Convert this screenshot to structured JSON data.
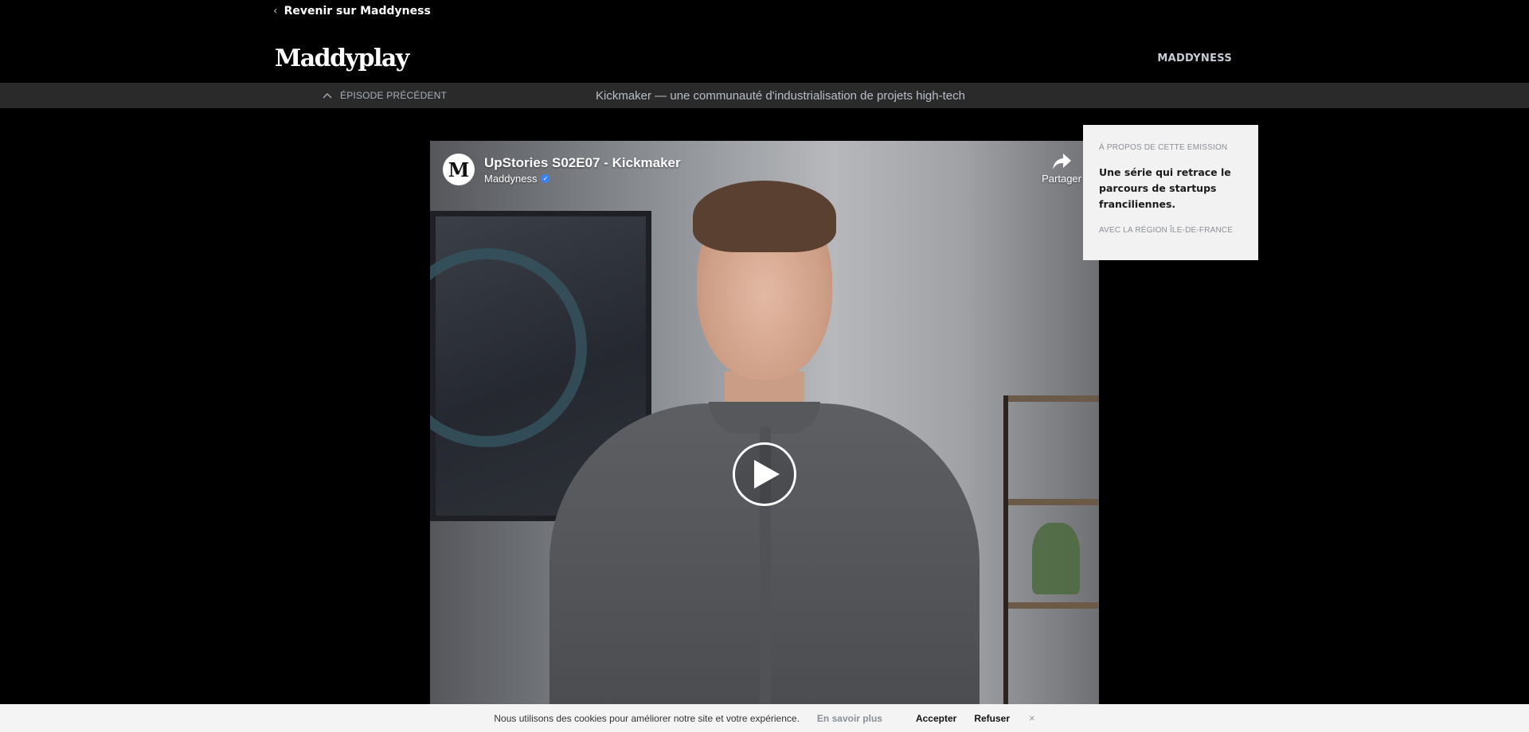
{
  "header": {
    "back_link": "Revenir sur Maddyness",
    "logo": "Maddyplay",
    "nav_link": "MADDYNESS"
  },
  "episode_bar": {
    "previous_label": "ÉPISODE PRÉCÉDENT",
    "current_title": "Kickmaker — une communauté d'industrialisation de projets high-tech"
  },
  "video": {
    "title": "UpStories S02E07 - Kickmaker",
    "channel": "Maddyness",
    "channel_avatar_letter": "M",
    "share_label": "Partager",
    "icons": [
      "play-icon",
      "share-icon",
      "verified-icon"
    ]
  },
  "about": {
    "eyebrow": "À PROPOS DE CETTE EMISSION",
    "text": "Une série qui retrace le parcours de startups franciliennes.",
    "partner": "AVEC LA RÉGION ÎLE-DE-FRANCE"
  },
  "cookie_bar": {
    "message": "Nous utilisons des cookies pour améliorer notre site et votre expérience.",
    "learn_more": "En savoir plus",
    "accept": "Accepter",
    "refuse": "Refuser",
    "close": "×"
  }
}
